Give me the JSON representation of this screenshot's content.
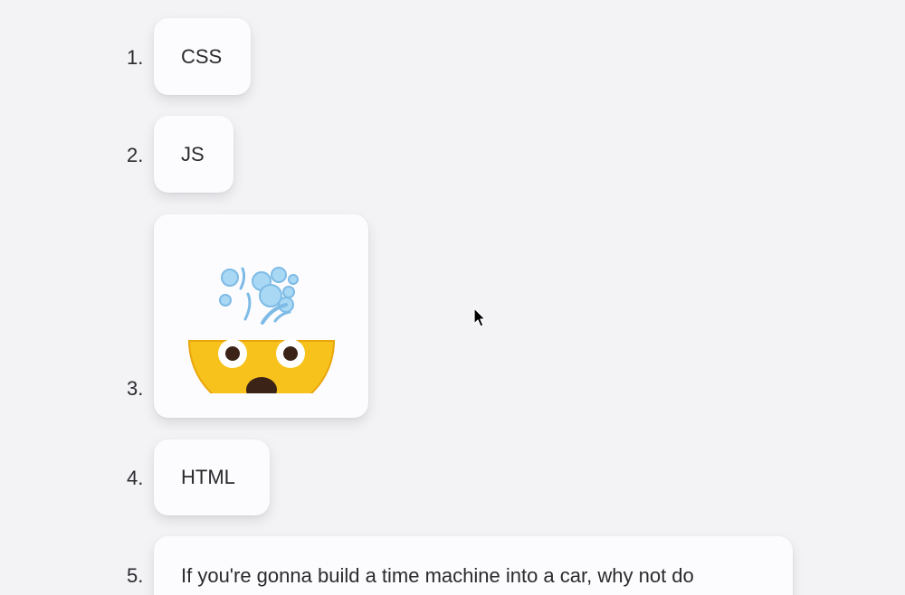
{
  "list": {
    "items": [
      {
        "number": "1.",
        "label": "CSS"
      },
      {
        "number": "2.",
        "label": "JS"
      },
      {
        "number": "3.",
        "icon": "exploding-head-emoji"
      },
      {
        "number": "4.",
        "label": "HTML"
      },
      {
        "number": "5.",
        "label": "If you're gonna build a time machine into a car, why not do"
      }
    ]
  },
  "colors": {
    "background": "#f3f3f6",
    "card": "#fcfcfe",
    "text": "#2b2b2f",
    "emoji_face": "#f7c21b",
    "emoji_bubbles": "#9fd3f3"
  }
}
